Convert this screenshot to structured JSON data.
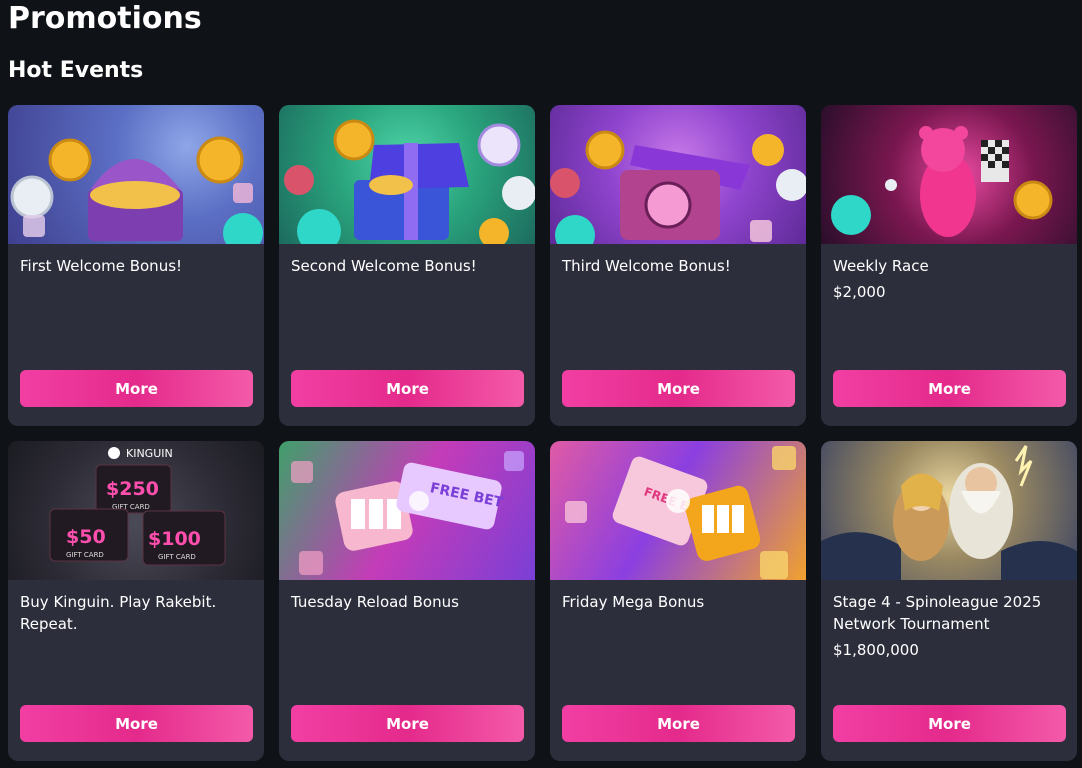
{
  "page": {
    "title": "Promotions"
  },
  "section": {
    "title": "Hot Events"
  },
  "cards": [
    {
      "title": "First Welcome Bonus!",
      "prize": "",
      "button": "More",
      "art": "treasure-chest-coins"
    },
    {
      "title": "Second Welcome Bonus!",
      "prize": "",
      "button": "More",
      "art": "gift-box-coins"
    },
    {
      "title": "Third Welcome Bonus!",
      "prize": "",
      "button": "More",
      "art": "open-box-coins"
    },
    {
      "title": "Weekly Race",
      "prize": "$2,000",
      "button": "More",
      "art": "pink-bear-race-flag"
    },
    {
      "title": "Buy Kinguin. Play Rakebit. Repeat.",
      "prize": "",
      "button": "More",
      "art": "kinguin-gift-cards",
      "banner_text": {
        "brand": "KINGUIN",
        "card_a": "$250",
        "card_b": "$50",
        "card_c": "$100",
        "gift": "GIFT CARD"
      }
    },
    {
      "title": "Tuesday Reload Bonus",
      "prize": "",
      "button": "More",
      "art": "slot-free-bet-ticket",
      "banner_text": {
        "ticket": "FREE BET"
      }
    },
    {
      "title": "Friday Mega Bonus",
      "prize": "",
      "button": "More",
      "art": "slot-free-bet-ticket-orange",
      "banner_text": {
        "ticket": "FREE BET"
      }
    },
    {
      "title": "Stage 4 - Spinoleague 2025 Network Tournament",
      "prize": "$1,800,000",
      "button": "More",
      "art": "zeus-goddess"
    }
  ],
  "colors": {
    "background": "#0f1318",
    "card": "#2d2e3c",
    "accent": "#f23fa3"
  }
}
